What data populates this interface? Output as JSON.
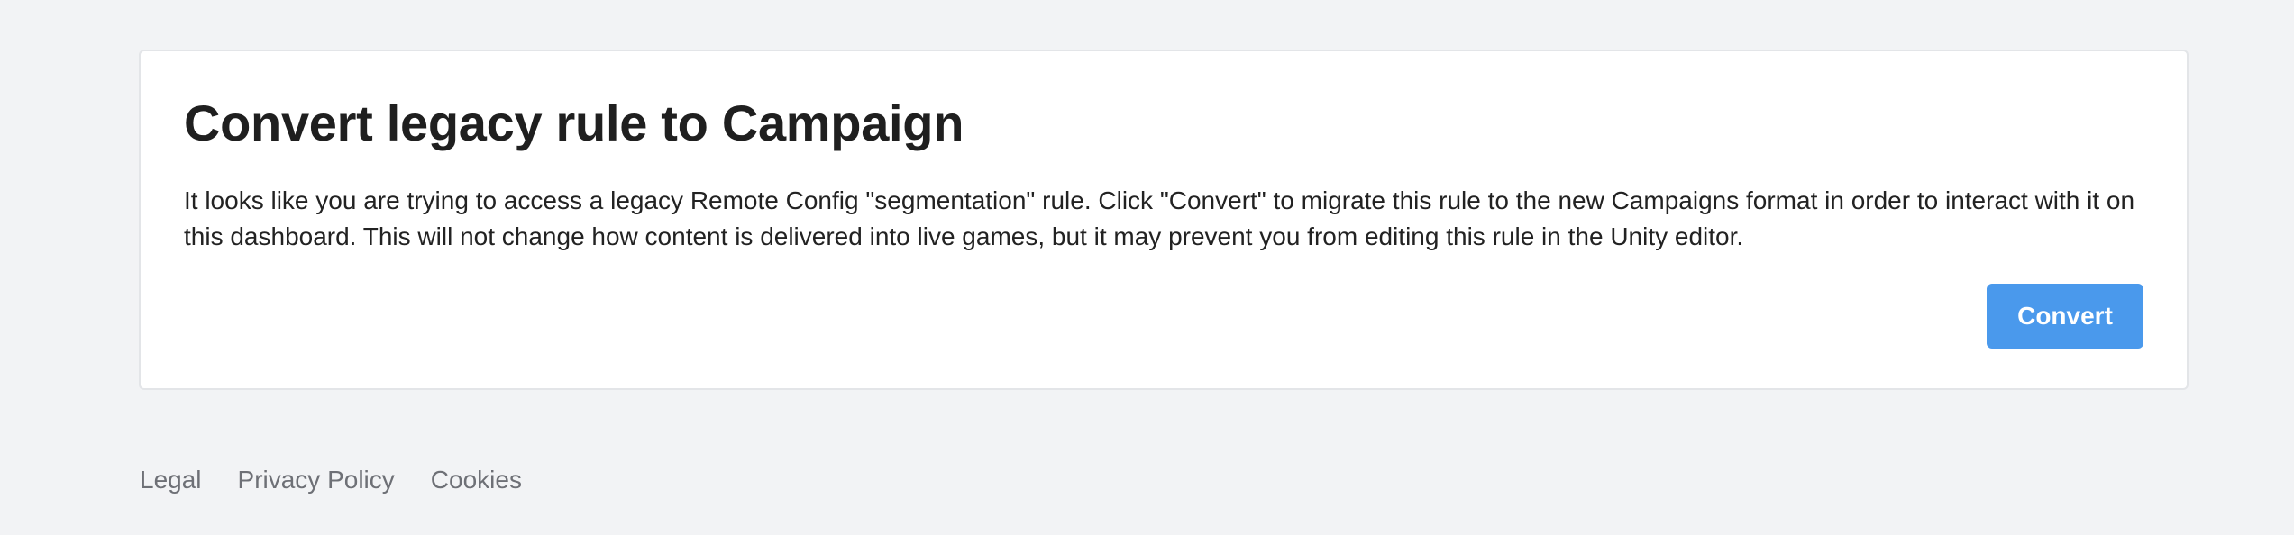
{
  "card": {
    "title": "Convert legacy rule to Campaign",
    "description": "It looks like you are trying to access a legacy Remote Config \"segmentation\" rule. Click \"Convert\" to migrate this rule to the new Campaigns format in order to interact with it on this dashboard. This will not change how content is delivered into live games, but it may prevent you from editing this rule in the Unity editor.",
    "convert_label": "Convert"
  },
  "footer": {
    "links": [
      {
        "label": "Legal"
      },
      {
        "label": "Privacy Policy"
      },
      {
        "label": "Cookies"
      }
    ]
  },
  "colors": {
    "page_background": "#f2f3f5",
    "card_background": "#ffffff",
    "primary_button": "#4a99ec",
    "footer_link": "#6e7076"
  }
}
